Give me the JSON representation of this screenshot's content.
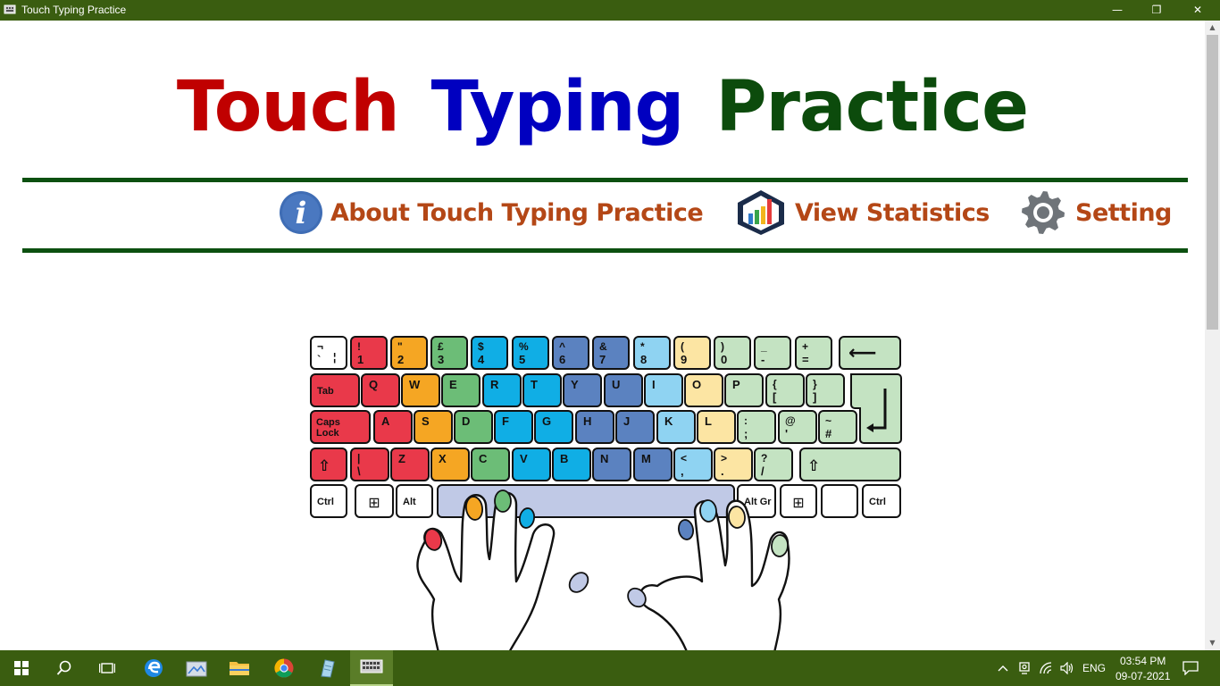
{
  "window": {
    "title": "Touch Typing Practice",
    "minimize_glyph": "—",
    "maximize_glyph": "❐",
    "close_glyph": "✕"
  },
  "heading": {
    "word1": "Touch",
    "word2": "Typing",
    "word3": "Practice",
    "color1": "#c00000",
    "color2": "#0000c0",
    "color3": "#0c4b0c"
  },
  "nav": {
    "about": "About Touch Typing Practice",
    "stats": "View Statistics",
    "setting": "Setting",
    "info_icon_glyph": "i",
    "label_color": "#b44716"
  },
  "keyboard": {
    "rows": [
      [
        {
          "top": "¬",
          "bottom": "`",
          "alt": "¦",
          "color": "white"
        },
        {
          "top": "!",
          "bottom": "1",
          "color": "red"
        },
        {
          "top": "\"",
          "bottom": "2",
          "color": "orange"
        },
        {
          "top": "£",
          "bottom": "3",
          "color": "green"
        },
        {
          "top": "$",
          "bottom": "4",
          "color": "cyan"
        },
        {
          "top": "%",
          "bottom": "5",
          "color": "cyan"
        },
        {
          "top": "^",
          "bottom": "6",
          "color": "steel"
        },
        {
          "top": "&",
          "bottom": "7",
          "color": "steel"
        },
        {
          "top": "*",
          "bottom": "8",
          "color": "lightblue"
        },
        {
          "top": "(",
          "bottom": "9",
          "color": "yellow"
        },
        {
          "top": ")",
          "bottom": "0",
          "color": "mint"
        },
        {
          "top": "_",
          "bottom": "-",
          "color": "mint"
        },
        {
          "top": "+",
          "bottom": "=",
          "color": "mint"
        },
        {
          "label": "⟵",
          "color": "mint",
          "wide": true
        }
      ],
      [
        {
          "label": "Tab",
          "color": "red"
        },
        {
          "label": "Q",
          "color": "red"
        },
        {
          "label": "W",
          "color": "orange"
        },
        {
          "label": "E",
          "color": "green"
        },
        {
          "label": "R",
          "color": "cyan"
        },
        {
          "label": "T",
          "color": "cyan"
        },
        {
          "label": "Y",
          "color": "steel"
        },
        {
          "label": "U",
          "color": "steel"
        },
        {
          "label": "I",
          "color": "lightblue"
        },
        {
          "label": "O",
          "color": "yellow"
        },
        {
          "label": "P",
          "color": "mint"
        },
        {
          "top": "{",
          "bottom": "[",
          "color": "mint"
        },
        {
          "top": "}",
          "bottom": "]",
          "color": "mint"
        }
      ],
      [
        {
          "label": "Caps Lock",
          "color": "red"
        },
        {
          "label": "A",
          "color": "red"
        },
        {
          "label": "S",
          "color": "orange"
        },
        {
          "label": "D",
          "color": "green"
        },
        {
          "label": "F",
          "color": "cyan"
        },
        {
          "label": "G",
          "color": "cyan"
        },
        {
          "label": "H",
          "color": "steel"
        },
        {
          "label": "J",
          "color": "steel"
        },
        {
          "label": "K",
          "color": "lightblue"
        },
        {
          "label": "L",
          "color": "yellow"
        },
        {
          "top": ":",
          "bottom": ";",
          "color": "mint"
        },
        {
          "top": "@",
          "bottom": "'",
          "color": "mint"
        },
        {
          "top": "~",
          "bottom": "#",
          "color": "mint"
        }
      ],
      [
        {
          "label": "⇧",
          "color": "red"
        },
        {
          "top": "|",
          "bottom": "\\",
          "color": "red"
        },
        {
          "label": "Z",
          "color": "red"
        },
        {
          "label": "X",
          "color": "orange"
        },
        {
          "label": "C",
          "color": "green"
        },
        {
          "label": "V",
          "color": "cyan"
        },
        {
          "label": "B",
          "color": "cyan"
        },
        {
          "label": "N",
          "color": "steel"
        },
        {
          "label": "M",
          "color": "steel"
        },
        {
          "top": "<",
          "bottom": ",",
          "color": "lightblue"
        },
        {
          "top": ">",
          "bottom": ".",
          "color": "yellow"
        },
        {
          "top": "?",
          "bottom": "/",
          "color": "mint"
        },
        {
          "label": "⇧",
          "color": "mint"
        }
      ],
      [
        {
          "label": "Ctrl",
          "color": "white"
        },
        {
          "label": "⊞",
          "color": "white"
        },
        {
          "label": "Alt",
          "color": "white"
        },
        {
          "label": "",
          "color": "lavender"
        },
        {
          "label": "Alt Gr",
          "color": "white"
        },
        {
          "label": "⊞",
          "color": "white"
        },
        {
          "label": "",
          "color": "white"
        },
        {
          "label": "Ctrl",
          "color": "white"
        }
      ]
    ],
    "colors": {
      "white": "#ffffff",
      "red": "#e9394a",
      "orange": "#f5a623",
      "green": "#6cbd77",
      "cyan": "#10aee5",
      "steel": "#5b82c0",
      "lightblue": "#8fd3f2",
      "yellow": "#fce5a3",
      "mint": "#c4e3c2",
      "lavender": "#c0c9e6"
    }
  },
  "taskbar": {
    "time": "03:54 PM",
    "date": "09-07-2021",
    "language": "ENG",
    "apps": [
      "start-icon",
      "search-icon",
      "task-view-icon",
      "edge-icon",
      "photos-icon",
      "file-explorer-icon",
      "chrome-icon",
      "notepad-icon",
      "typing-app-icon"
    ]
  }
}
